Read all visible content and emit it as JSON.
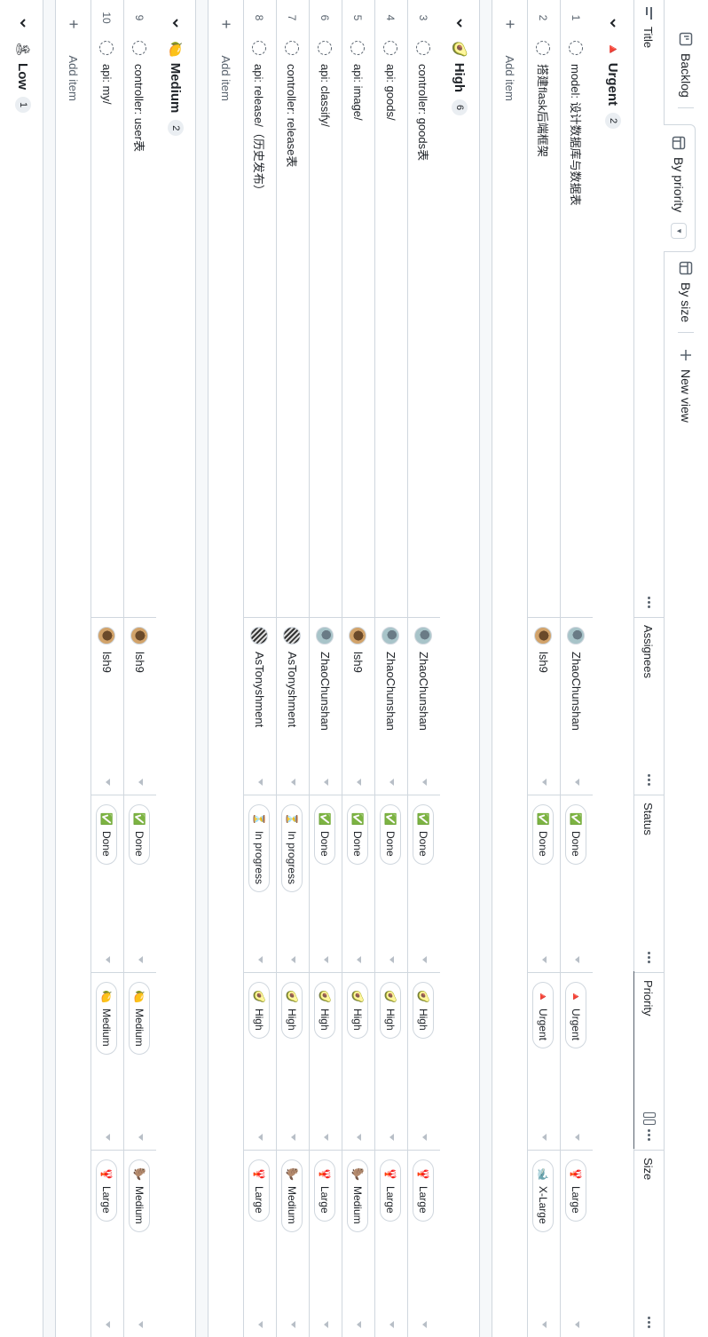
{
  "tabs": [
    {
      "label": "Backlog",
      "icon": "board-icon"
    },
    {
      "label": "By priority",
      "icon": "table-icon",
      "active": true
    },
    {
      "label": "By size",
      "icon": "table-icon"
    },
    {
      "label": "New view",
      "icon": "plus-icon"
    }
  ],
  "columns": {
    "title": "Title",
    "assignees": "Assignees",
    "status": "Status",
    "priority": "Priority",
    "size": "Size"
  },
  "add_item_label": "Add item",
  "groups": [
    {
      "name": "Urgent",
      "emoji": "🔺",
      "count": "2",
      "rows": [
        {
          "num": "1",
          "title": "model: 设计数据库与数据表",
          "assignee": "ZhaoChunshan",
          "avatar": "av-zhao",
          "status": "Done",
          "status_icon": "✅",
          "priority": "Urgent",
          "priority_icon": "🔺",
          "size": "Large",
          "size_icon": "🦞"
        },
        {
          "num": "2",
          "title": "搭建flask后端框架",
          "assignee": "lsh9",
          "avatar": "av-lsh",
          "status": "Done",
          "status_icon": "✅",
          "priority": "Urgent",
          "priority_icon": "🔺",
          "size": "X-Large",
          "size_icon": "🐋"
        }
      ]
    },
    {
      "name": "High",
      "emoji": "🥑",
      "count": "6",
      "rows": [
        {
          "num": "3",
          "title": "controller: goods表",
          "assignee": "ZhaoChunshan",
          "avatar": "av-zhao",
          "status": "Done",
          "status_icon": "✅",
          "priority": "High",
          "priority_icon": "🥑",
          "size": "Large",
          "size_icon": "🦞"
        },
        {
          "num": "4",
          "title": "api: goods/",
          "assignee": "ZhaoChunshan",
          "avatar": "av-zhao",
          "status": "Done",
          "status_icon": "✅",
          "priority": "High",
          "priority_icon": "🥑",
          "size": "Large",
          "size_icon": "🦞"
        },
        {
          "num": "5",
          "title": "api: image/",
          "assignee": "lsh9",
          "avatar": "av-lsh",
          "status": "Done",
          "status_icon": "✅",
          "priority": "High",
          "priority_icon": "🥑",
          "size": "Medium",
          "size_icon": "🦫"
        },
        {
          "num": "6",
          "title": "api: classify/",
          "assignee": "ZhaoChunshan",
          "avatar": "av-zhao",
          "status": "Done",
          "status_icon": "✅",
          "priority": "High",
          "priority_icon": "🥑",
          "size": "Large",
          "size_icon": "🦞"
        },
        {
          "num": "7",
          "title": "controller: release表",
          "assignee": "AsTonyshment",
          "avatar": "av-ast",
          "status": "In progress",
          "status_icon": "⏳",
          "priority": "High",
          "priority_icon": "🥑",
          "size": "Medium",
          "size_icon": "🦫"
        },
        {
          "num": "8",
          "title": "api: release/（历史发布）",
          "assignee": "AsTonyshment",
          "avatar": "av-ast",
          "status": "In progress",
          "status_icon": "⏳",
          "priority": "High",
          "priority_icon": "🥑",
          "size": "Large",
          "size_icon": "🦞"
        }
      ]
    },
    {
      "name": "Medium",
      "emoji": "🍋",
      "count": "2",
      "rows": [
        {
          "num": "9",
          "title": "controller: user表",
          "assignee": "lsh9",
          "avatar": "av-lsh",
          "status": "Done",
          "status_icon": "✅",
          "priority": "Medium",
          "priority_icon": "🍋",
          "size": "Medium",
          "size_icon": "🦫"
        },
        {
          "num": "10",
          "title": "api: my/",
          "assignee": "lsh9",
          "avatar": "av-lsh",
          "status": "Done",
          "status_icon": "✅",
          "priority": "Medium",
          "priority_icon": "🍋",
          "size": "Large",
          "size_icon": "🦞"
        }
      ]
    },
    {
      "name": "Low",
      "emoji": "🏝",
      "count": "1",
      "rows": []
    }
  ]
}
